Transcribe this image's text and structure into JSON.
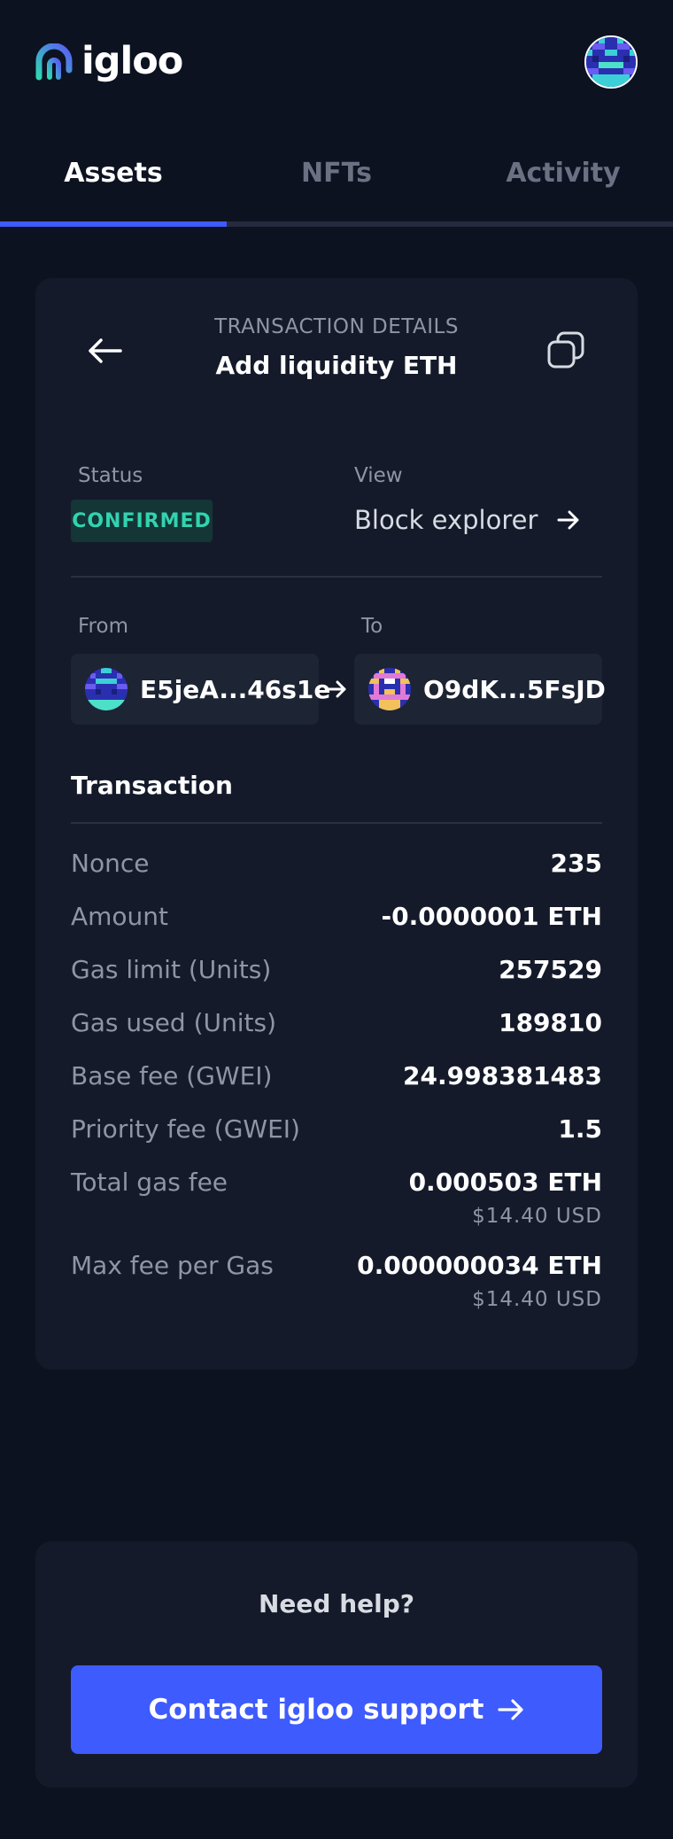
{
  "brand": {
    "name": "igloo",
    "accent": "#3e5bfd",
    "teal": "#32d3b0",
    "logo_icon": "igloo-logo-icon",
    "user_avatar_icon": "pixel-avatar-icon"
  },
  "tabs": [
    {
      "label": "Assets",
      "active": true
    },
    {
      "label": "NFTs",
      "active": false
    },
    {
      "label": "Activity",
      "active": false
    }
  ],
  "details": {
    "subtitle": "TRANSACTION DETAILS",
    "title": "Add liquidity ETH",
    "back_icon": "arrow-left-icon",
    "copy_icon": "copy-icon",
    "status_label": "Status",
    "status_value": "CONFIRMED",
    "view_label": "View",
    "view_link": "Block explorer",
    "from_label": "From",
    "from_address": "E5jeA...46s1e",
    "to_label": "To",
    "to_address": "O9dK...5FsJD",
    "section_title": "Transaction"
  },
  "rows": [
    {
      "label": "Nonce",
      "value": "235"
    },
    {
      "label": "Amount",
      "value": "-0.0000001 ETH"
    },
    {
      "label": "Gas limit (Units)",
      "value": "257529"
    },
    {
      "label": "Gas used (Units)",
      "value": "189810"
    },
    {
      "label": "Base fee (GWEI)",
      "value": "24.998381483"
    },
    {
      "label": "Priority fee (GWEI)",
      "value": "1.5"
    },
    {
      "label": "Total gas fee",
      "value": "0.000503 ETH",
      "sub": "$14.40 USD"
    },
    {
      "label": "Max fee per Gas",
      "value": "0.000000034 ETH",
      "sub": "$14.40 USD"
    }
  ],
  "help": {
    "title": "Need help?",
    "button_label": "Contact igloo support",
    "button_icon": "arrow-right-icon"
  }
}
